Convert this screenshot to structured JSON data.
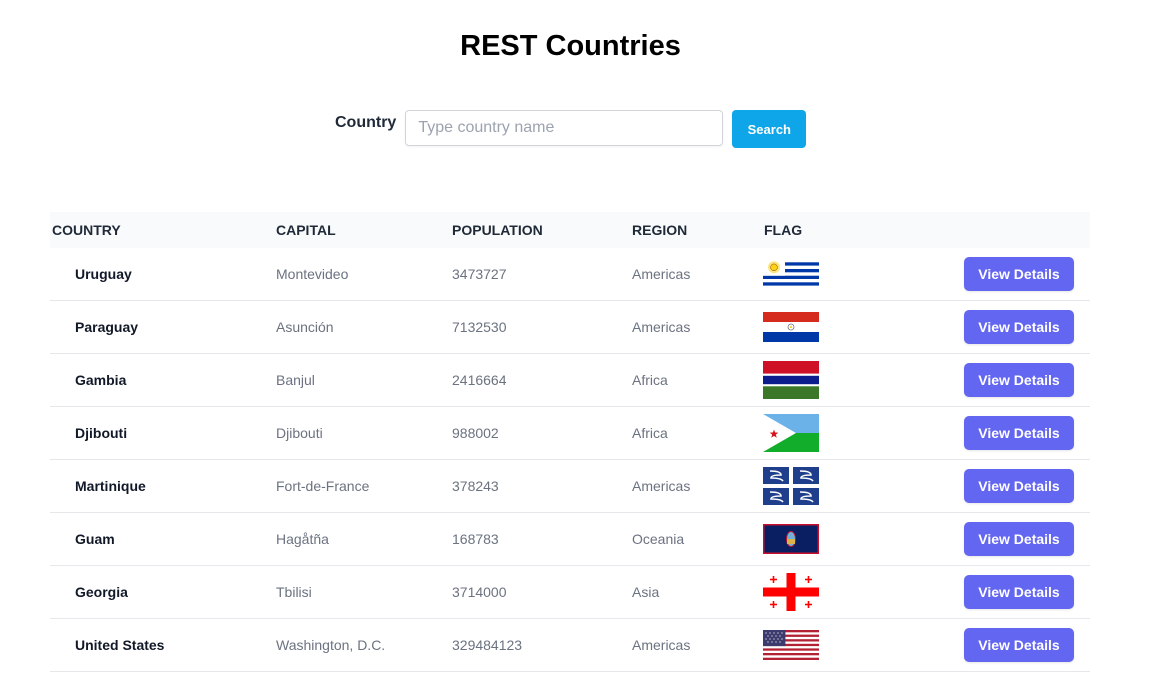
{
  "header": {
    "title": "REST Countries"
  },
  "search": {
    "label": "Country",
    "placeholder": "Type country name",
    "value": "",
    "button_label": "Search",
    "button_color": "#0ea5e9"
  },
  "table": {
    "columns": [
      "COUNTRY",
      "CAPITAL",
      "POPULATION",
      "REGION",
      "FLAG"
    ],
    "action_label": "View Details",
    "action_color": "#6366f1",
    "rows": [
      {
        "country": "Uruguay",
        "capital": "Montevideo",
        "population": "3473727",
        "region": "Americas",
        "flag_icon": "uruguay-flag-icon"
      },
      {
        "country": "Paraguay",
        "capital": "Asunción",
        "population": "7132530",
        "region": "Americas",
        "flag_icon": "paraguay-flag-icon"
      },
      {
        "country": "Gambia",
        "capital": "Banjul",
        "population": "2416664",
        "region": "Africa",
        "flag_icon": "gambia-flag-icon"
      },
      {
        "country": "Djibouti",
        "capital": "Djibouti",
        "population": "988002",
        "region": "Africa",
        "flag_icon": "djibouti-flag-icon"
      },
      {
        "country": "Martinique",
        "capital": "Fort-de-France",
        "population": "378243",
        "region": "Americas",
        "flag_icon": "martinique-flag-icon"
      },
      {
        "country": "Guam",
        "capital": "Hagåtña",
        "population": "168783",
        "region": "Oceania",
        "flag_icon": "guam-flag-icon"
      },
      {
        "country": "Georgia",
        "capital": "Tbilisi",
        "population": "3714000",
        "region": "Asia",
        "flag_icon": "georgia-flag-icon"
      },
      {
        "country": "United States",
        "capital": "Washington, D.C.",
        "population": "329484123",
        "region": "Americas",
        "flag_icon": "usa-flag-icon"
      }
    ]
  }
}
